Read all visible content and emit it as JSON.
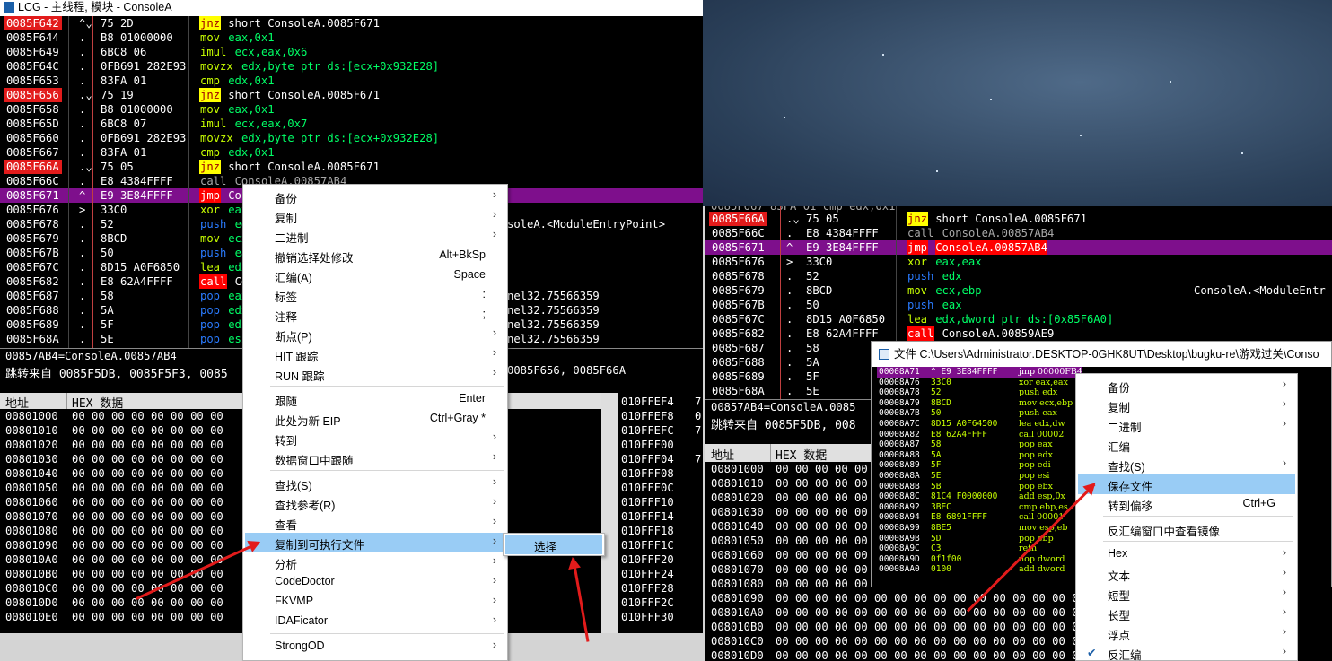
{
  "main_window": {
    "title": "LCG - 主线程, 模块 - ConsoleA",
    "rows": [
      {
        "addr": "0085F642",
        "bp": true,
        "mark": "^⌄",
        "hex": "75 2D",
        "mn": "jnz",
        "mnstyle": "yellow",
        "ops": "short ConsoleA.0085F671",
        "opstyle": "white"
      },
      {
        "addr": "0085F644",
        "bp": false,
        "mark": ".",
        "hex": "B8 01000000",
        "mn": "mov",
        "mnstyle": "lime",
        "ops": "eax,0x1",
        "opstyle": "green"
      },
      {
        "addr": "0085F649",
        "bp": false,
        "mark": ".",
        "hex": "6BC8 06",
        "mn": "imul",
        "mnstyle": "lime",
        "ops": "ecx,eax,0x6",
        "opstyle": "green"
      },
      {
        "addr": "0085F64C",
        "bp": false,
        "mark": ".",
        "hex": "0FB691 282E93",
        "mn": "movzx",
        "mnstyle": "lime",
        "ops": "edx,byte ptr ds:[ecx+0x932E28]",
        "opstyle": "green"
      },
      {
        "addr": "0085F653",
        "bp": false,
        "mark": ".",
        "hex": "83FA 01",
        "mn": "cmp",
        "mnstyle": "lime",
        "ops": "edx,0x1",
        "opstyle": "green"
      },
      {
        "addr": "0085F656",
        "bp": true,
        "mark": ".⌄",
        "hex": "75 19",
        "mn": "jnz",
        "mnstyle": "yellow",
        "ops": "short ConsoleA.0085F671",
        "opstyle": "white"
      },
      {
        "addr": "0085F658",
        "bp": false,
        "mark": ".",
        "hex": "B8 01000000",
        "mn": "mov",
        "mnstyle": "lime",
        "ops": "eax,0x1",
        "opstyle": "green"
      },
      {
        "addr": "0085F65D",
        "bp": false,
        "mark": ".",
        "hex": "6BC8 07",
        "mn": "imul",
        "mnstyle": "lime",
        "ops": "ecx,eax,0x7",
        "opstyle": "green"
      },
      {
        "addr": "0085F660",
        "bp": false,
        "mark": ".",
        "hex": "0FB691 282E93",
        "mn": "movzx",
        "mnstyle": "lime",
        "ops": "edx,byte ptr ds:[ecx+0x932E28]",
        "opstyle": "green"
      },
      {
        "addr": "0085F667",
        "bp": false,
        "mark": ".",
        "hex": "83FA 01",
        "mn": "cmp",
        "mnstyle": "lime",
        "ops": "edx,0x1",
        "opstyle": "green"
      },
      {
        "addr": "0085F66A",
        "bp": true,
        "mark": ".⌄",
        "hex": "75 05",
        "mn": "jnz",
        "mnstyle": "yellow",
        "ops": "short ConsoleA.0085F671",
        "opstyle": "white"
      },
      {
        "addr": "0085F66C",
        "bp": false,
        "mark": ".",
        "hex": "E8 4384FFFF",
        "mn": "call",
        "mnstyle": "gray",
        "ops": "ConsoleA.00857AB4",
        "opstyle": "gray"
      },
      {
        "addr": "0085F671",
        "bp": false,
        "mark": "^",
        "hex": "E9 3E84FFFF",
        "mn": "jmp",
        "mnstyle": "red",
        "ops": "Cons",
        "opstyle": "white",
        "jmpline": true
      },
      {
        "addr": "0085F676",
        "bp": false,
        "mark": ">",
        "hex": "33C0",
        "mn": "xor",
        "mnstyle": "lime",
        "ops": "eax",
        "opstyle": "green"
      },
      {
        "addr": "0085F678",
        "bp": false,
        "mark": ".",
        "hex": "52",
        "mn": "push",
        "mnstyle": "blue",
        "ops": "ed",
        "opstyle": "green"
      },
      {
        "addr": "0085F679",
        "bp": false,
        "mark": ".",
        "hex": "8BCD",
        "mn": "mov",
        "mnstyle": "lime",
        "ops": "ecx",
        "opstyle": "green"
      },
      {
        "addr": "0085F67B",
        "bp": false,
        "mark": ".",
        "hex": "50",
        "mn": "push",
        "mnstyle": "blue",
        "ops": "ea",
        "opstyle": "green"
      },
      {
        "addr": "0085F67C",
        "bp": false,
        "mark": ".",
        "hex": "8D15 A0F6850",
        "mn": "lea",
        "mnstyle": "lime",
        "ops": "edx",
        "opstyle": "green"
      },
      {
        "addr": "0085F682",
        "bp": false,
        "mark": ".",
        "hex": "E8 62A4FFFF",
        "mn": "call",
        "mnstyle": "red",
        "ops": "Co",
        "opstyle": "white"
      },
      {
        "addr": "0085F687",
        "bp": false,
        "mark": ".",
        "hex": "58",
        "mn": "pop",
        "mnstyle": "blue",
        "ops": "eax",
        "opstyle": "green"
      },
      {
        "addr": "0085F688",
        "bp": false,
        "mark": ".",
        "hex": "5A",
        "mn": "pop",
        "mnstyle": "blue",
        "ops": "edx",
        "opstyle": "green"
      },
      {
        "addr": "0085F689",
        "bp": false,
        "mark": ".",
        "hex": "5F",
        "mn": "pop",
        "mnstyle": "blue",
        "ops": "edi",
        "opstyle": "green"
      },
      {
        "addr": "0085F68A",
        "bp": false,
        "mark": ".",
        "hex": "5E",
        "mn": "pop",
        "mnstyle": "blue",
        "ops": "esi",
        "opstyle": "green"
      }
    ],
    "comments": [
      "soleA.<ModuleEntryPoint>",
      "nel32.75566359",
      "nel32.75566359",
      "nel32.75566359",
      "nel32.75566359"
    ],
    "info_line1": "00857AB4=ConsoleA.00857AB4",
    "info_line2": "跳转来自  0085F5DB, 0085F5F3, 0085",
    "info_line2_tail": "0085F656, 0085F66A",
    "hex_header_addr": "地址",
    "hex_header_data": "HEX 数据",
    "mem_rows": [
      "00801000",
      "00801010",
      "00801020",
      "00801030",
      "00801040",
      "00801050",
      "00801060",
      "00801070",
      "00801080",
      "00801090",
      "008010A0",
      "008010B0",
      "008010C0",
      "008010D0",
      "008010E0"
    ],
    "mem_bytes": "00 00 00 00 00 00 00 00",
    "stack_rows": [
      "010FFEF4",
      "010FFEF8",
      "010FFEFC",
      "010FFF00",
      "010FFF04",
      "010FFF08",
      "010FFF0C",
      "010FFF10",
      "010FFF14",
      "010FFF18",
      "010FFF1C",
      "010FFF20",
      "010FFF24",
      "010FFF28",
      "010FFF2C",
      "010FFF30"
    ],
    "stack_col2": [
      "7",
      "0",
      "7",
      "",
      "7",
      "",
      "",
      "",
      "",
      "",
      "",
      "",
      "",
      "",
      "",
      ""
    ]
  },
  "context_menu": {
    "items": [
      {
        "label": "备份",
        "shortcut": "",
        "arrow": true
      },
      {
        "label": "复制",
        "shortcut": "",
        "arrow": true
      },
      {
        "label": "二进制",
        "shortcut": "",
        "arrow": true
      },
      {
        "label": "撤销选择处修改",
        "shortcut": "Alt+BkSp",
        "arrow": false
      },
      {
        "label": "汇编(A)",
        "shortcut": "Space",
        "arrow": false
      },
      {
        "label": "标签",
        "shortcut": ":",
        "arrow": false
      },
      {
        "label": "注释",
        "shortcut": ";",
        "arrow": false
      },
      {
        "label": "断点(P)",
        "shortcut": "",
        "arrow": true
      },
      {
        "label": "HIT 跟踪",
        "shortcut": "",
        "arrow": true
      },
      {
        "label": "RUN 跟踪",
        "shortcut": "",
        "arrow": true
      },
      {
        "label": "跟随",
        "shortcut": "Enter",
        "arrow": false,
        "sep_before": true
      },
      {
        "label": "此处为新 EIP",
        "shortcut": "Ctrl+Gray *",
        "arrow": false
      },
      {
        "label": "转到",
        "shortcut": "",
        "arrow": true
      },
      {
        "label": "数据窗口中跟随",
        "shortcut": "",
        "arrow": true
      },
      {
        "label": "查找(S)",
        "shortcut": "",
        "arrow": true,
        "sep_before": true
      },
      {
        "label": "查找参考(R)",
        "shortcut": "",
        "arrow": true
      },
      {
        "label": "查看",
        "shortcut": "",
        "arrow": true
      },
      {
        "label": "复制到可执行文件",
        "shortcut": "",
        "arrow": true,
        "highlight": true
      },
      {
        "label": "分析",
        "shortcut": "",
        "arrow": true
      },
      {
        "label": "CodeDoctor",
        "shortcut": "",
        "arrow": true
      },
      {
        "label": "FKVMP",
        "shortcut": "",
        "arrow": true
      },
      {
        "label": "IDAFicator",
        "shortcut": "",
        "arrow": true
      },
      {
        "label": "StrongOD",
        "shortcut": "",
        "arrow": true,
        "sep_before": true
      }
    ],
    "submenu_label": "选择"
  },
  "right_window": {
    "rows": [
      {
        "addr": "0085F66A",
        "bp": true,
        "mark": ".⌄",
        "hex": "75 05",
        "mn": "jnz",
        "mnstyle": "yellow",
        "ops": "short ConsoleA.0085F671",
        "opstyle": "white"
      },
      {
        "addr": "0085F66C",
        "bp": false,
        "mark": ".",
        "hex": "E8 4384FFFF",
        "mn": "call",
        "mnstyle": "gray",
        "ops": "ConsoleA.00857AB4",
        "opstyle": "gray"
      },
      {
        "addr": "0085F671",
        "bp": false,
        "mark": "^",
        "hex": "E9 3E84FFFF",
        "mn": "jmp",
        "mnstyle": "red",
        "ops": "ConsoleA.00857AB4",
        "opstyle": "red",
        "jmpline": true
      },
      {
        "addr": "0085F676",
        "bp": false,
        "mark": ">",
        "hex": "33C0",
        "mn": "xor",
        "mnstyle": "lime",
        "ops": "eax,eax",
        "opstyle": "green"
      },
      {
        "addr": "0085F678",
        "bp": false,
        "mark": ".",
        "hex": "52",
        "mn": "push",
        "mnstyle": "blue",
        "ops": "edx",
        "opstyle": "green"
      },
      {
        "addr": "0085F679",
        "bp": false,
        "mark": ".",
        "hex": "8BCD",
        "mn": "mov",
        "mnstyle": "lime",
        "ops": "ecx,ebp",
        "opstyle": "green"
      },
      {
        "addr": "0085F67B",
        "bp": false,
        "mark": ".",
        "hex": "50",
        "mn": "push",
        "mnstyle": "blue",
        "ops": "eax",
        "opstyle": "green"
      },
      {
        "addr": "0085F67C",
        "bp": false,
        "mark": ".",
        "hex": "8D15 A0F6850",
        "mn": "lea",
        "mnstyle": "lime",
        "ops": "edx,dword ptr ds:[0x85F6A0]",
        "opstyle": "green"
      },
      {
        "addr": "0085F682",
        "bp": false,
        "mark": ".",
        "hex": "E8 62A4FFFF",
        "mn": "call",
        "mnstyle": "red",
        "ops": "ConsoleA.00859AE9",
        "opstyle": "white"
      },
      {
        "addr": "0085F687",
        "bp": false,
        "mark": ".",
        "hex": "58",
        "mn": "",
        "mnstyle": "blue",
        "ops": "",
        "opstyle": "green"
      },
      {
        "addr": "0085F688",
        "bp": false,
        "mark": ".",
        "hex": "5A",
        "mn": "",
        "mnstyle": "blue",
        "ops": "",
        "opstyle": "green"
      },
      {
        "addr": "0085F689",
        "bp": false,
        "mark": ".",
        "hex": "5F",
        "mn": "",
        "mnstyle": "blue",
        "ops": "",
        "opstyle": "green"
      },
      {
        "addr": "0085F68A",
        "bp": false,
        "mark": ".",
        "hex": "5E",
        "mn": "",
        "mnstyle": "blue",
        "ops": "",
        "opstyle": "green"
      }
    ],
    "partial_top_row": "0085F667  83FA 01       cmp edx,0x1",
    "comment": "ConsoleA.<ModuleEntr",
    "info_line1": "00857AB4=ConsoleA.0085",
    "info_line2": "跳转来自  0085F5DB, 008",
    "hex_header_addr": "地址",
    "hex_header_data": "HEX 数据",
    "mem_rows": [
      "00801000",
      "00801010",
      "00801020",
      "00801030",
      "00801040",
      "00801050",
      "00801060",
      "00801070",
      "00801080",
      "00801090",
      "008010A0",
      "008010B0",
      "008010C0",
      "008010D0"
    ],
    "mem_bytes": "00 00 00 00 00 00 00 00 00 00 00 00 00 00 00 00"
  },
  "file_window": {
    "title": "文件 C:\\Users\\Administrator.DESKTOP-0GHK8UT\\Desktop\\bugku-re\\游戏过关\\Conso",
    "rows": [
      {
        "addr": "00008A71",
        "hex": "^ E9 3E84FFFF",
        "asm": "jmp 00000FB4",
        "hl": true
      },
      {
        "addr": "00008A76",
        "hex": "33C0",
        "asm": "xor eax,eax"
      },
      {
        "addr": "00008A78",
        "hex": "52",
        "asm": "push edx"
      },
      {
        "addr": "00008A79",
        "hex": "8BCD",
        "asm": "mov ecx,ebp"
      },
      {
        "addr": "00008A7B",
        "hex": "50",
        "asm": "push eax"
      },
      {
        "addr": "00008A7C",
        "hex": "8D15 A0F64500",
        "asm": "lea edx,dw"
      },
      {
        "addr": "00008A82",
        "hex": "E8 62A4FFFF",
        "asm": "call 00002"
      },
      {
        "addr": "00008A87",
        "hex": "58",
        "asm": "pop eax"
      },
      {
        "addr": "00008A88",
        "hex": "5A",
        "asm": "pop edx"
      },
      {
        "addr": "00008A89",
        "hex": "5F",
        "asm": "pop edi"
      },
      {
        "addr": "00008A8A",
        "hex": "5E",
        "asm": "pop esi"
      },
      {
        "addr": "00008A8B",
        "hex": "5B",
        "asm": "pop ebx"
      },
      {
        "addr": "00008A8C",
        "hex": "81C4 F0000000",
        "asm": "add esp,0x"
      },
      {
        "addr": "00008A92",
        "hex": "3BEC",
        "asm": "cmp ebp,es"
      },
      {
        "addr": "00008A94",
        "hex": "E8 6891FFFF",
        "asm": "call 00001"
      },
      {
        "addr": "00008A99",
        "hex": "8BE5",
        "asm": "mov esp,eb"
      },
      {
        "addr": "00008A9B",
        "hex": "5D",
        "asm": "pop ebp"
      },
      {
        "addr": "00008A9C",
        "hex": "C3",
        "asm": "retn"
      },
      {
        "addr": "00008A9D",
        "hex": "0f1f00",
        "asm": "nop dword"
      },
      {
        "addr": "00008AA0",
        "hex": "0100",
        "asm": "add dword"
      }
    ]
  },
  "file_menu": {
    "items": [
      {
        "label": "备份",
        "arrow": true,
        "shortcut": ""
      },
      {
        "label": "复制",
        "arrow": true,
        "shortcut": ""
      },
      {
        "label": "二进制",
        "arrow": true,
        "shortcut": ""
      },
      {
        "label": "汇编",
        "arrow": false,
        "shortcut": ""
      },
      {
        "label": "查找(S)",
        "arrow": true,
        "shortcut": ""
      },
      {
        "label": "保存文件",
        "arrow": false,
        "shortcut": "",
        "highlight": true
      },
      {
        "label": "转到偏移",
        "arrow": false,
        "shortcut": "Ctrl+G"
      },
      {
        "label": "反汇编窗口中查看镜像",
        "arrow": false,
        "shortcut": "",
        "sep_before": true
      },
      {
        "label": "Hex",
        "arrow": true,
        "shortcut": "",
        "sep_before": true
      },
      {
        "label": "文本",
        "arrow": true,
        "shortcut": ""
      },
      {
        "label": "短型",
        "arrow": true,
        "shortcut": ""
      },
      {
        "label": "长型",
        "arrow": true,
        "shortcut": ""
      },
      {
        "label": "浮点",
        "arrow": true,
        "shortcut": ""
      },
      {
        "label": "反汇编",
        "arrow": true,
        "shortcut": "",
        "checked": true
      }
    ]
  },
  "colors": {
    "accent": "#99ccf5",
    "breakpoint": "#e21b1b",
    "jmp_line": "#7e0f8c",
    "arrow": "#e21b1b"
  }
}
